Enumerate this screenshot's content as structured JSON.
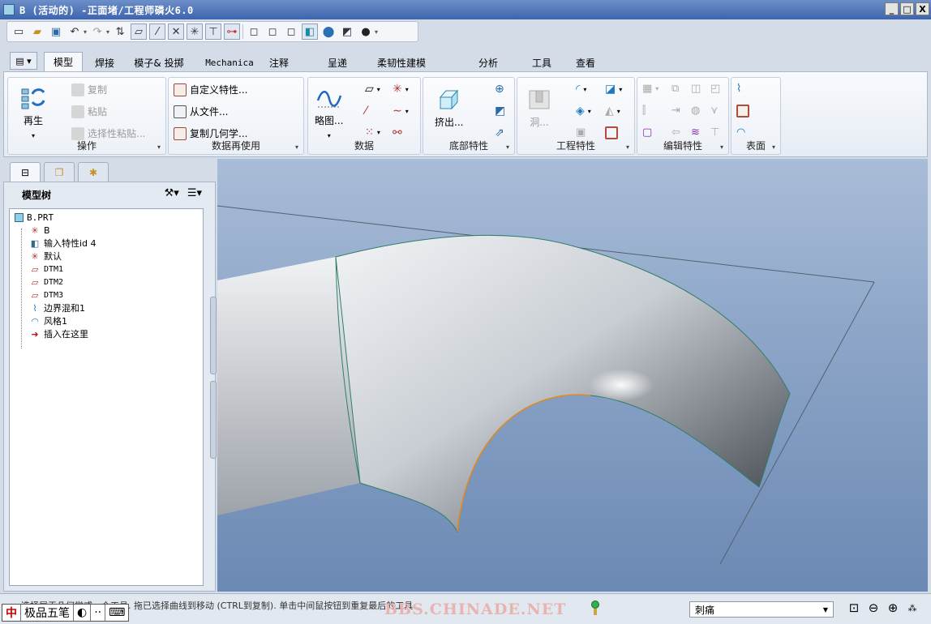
{
  "window": {
    "title": "B (活动的) -正面堵/工程师磷火6.0",
    "controls": [
      "_",
      "□",
      "X"
    ]
  },
  "quick_access": {
    "icons": [
      "new-icon",
      "open-icon",
      "save-icon",
      "undo-icon",
      "redo-icon",
      "regenerate-icon",
      "plane-display-icon",
      "axis-display-icon",
      "point-display-icon",
      "csys-display-icon",
      "annotation-display-icon",
      "spin-center-icon",
      "wireframe-icon",
      "hidden-line-icon",
      "no-hidden-icon",
      "shading-icon",
      "appearance-icon",
      "render-icon",
      "sphere-icon"
    ]
  },
  "ribbon_tabs": [
    {
      "label": "模型",
      "active": true
    },
    {
      "label": "焊接"
    },
    {
      "label": "模子& 投掷"
    },
    {
      "label": "Mechanica"
    },
    {
      "label": "注释"
    },
    {
      "label": "呈递"
    },
    {
      "label": "柔韧性建模"
    },
    {
      "label": "分析"
    },
    {
      "label": "工具"
    },
    {
      "label": "查看"
    }
  ],
  "ribbon_groups": {
    "operations": {
      "label": "操作",
      "regen_label": "再生",
      "copy_label": "复制",
      "paste_label": "粘贴",
      "paste_special_label": "选择性粘贴..."
    },
    "data_reuse": {
      "label": "数据再使用",
      "udf_label": "自定义特性...",
      "from_file_label": "从文件...",
      "copy_geom_label": "复制几何学..."
    },
    "datum": {
      "label": "数据",
      "sketch_label": "略图..."
    },
    "base_features": {
      "label": "底部特性",
      "extrude_label": "挤出..."
    },
    "engineering": {
      "label": "工程特性",
      "hole_label": "洞..."
    },
    "editing": {
      "label": "编辑特性"
    },
    "surfaces": {
      "label": "表面"
    }
  },
  "model_tree": {
    "header": "模型树",
    "items": [
      {
        "label": "B.PRT",
        "icon": "part-icon"
      },
      {
        "label": "B",
        "icon": "csys-icon"
      },
      {
        "label": "输入特性id 4",
        "icon": "import-feature-icon"
      },
      {
        "label": "默认",
        "icon": "csys-icon"
      },
      {
        "label": "DTM1",
        "icon": "datum-plane-icon"
      },
      {
        "label": "DTM2",
        "icon": "datum-plane-icon"
      },
      {
        "label": "DTM3",
        "icon": "datum-plane-icon"
      },
      {
        "label": "边界混和1",
        "icon": "boundary-blend-icon"
      },
      {
        "label": "风格1",
        "icon": "style-icon"
      },
      {
        "label": "插入在这里",
        "icon": "insert-here-icon"
      }
    ]
  },
  "status": {
    "message": "• 选择属于几何学或一个工具. 拖已选择曲线到移动 (CTRL到复制). 单击中间鼠按钮到重复最后的工具.",
    "filter_value": "刺痛",
    "watermark": "BBS.CHINADE.NET",
    "ime_labels": [
      "极品五笔"
    ]
  },
  "colors": {
    "accent": "#3d64ad",
    "viewport_top": "#a9bdd8",
    "viewport_bottom": "#6b89b4",
    "surface_edge": "#2f7d6a",
    "highlight_edge": "#e08a1e"
  }
}
